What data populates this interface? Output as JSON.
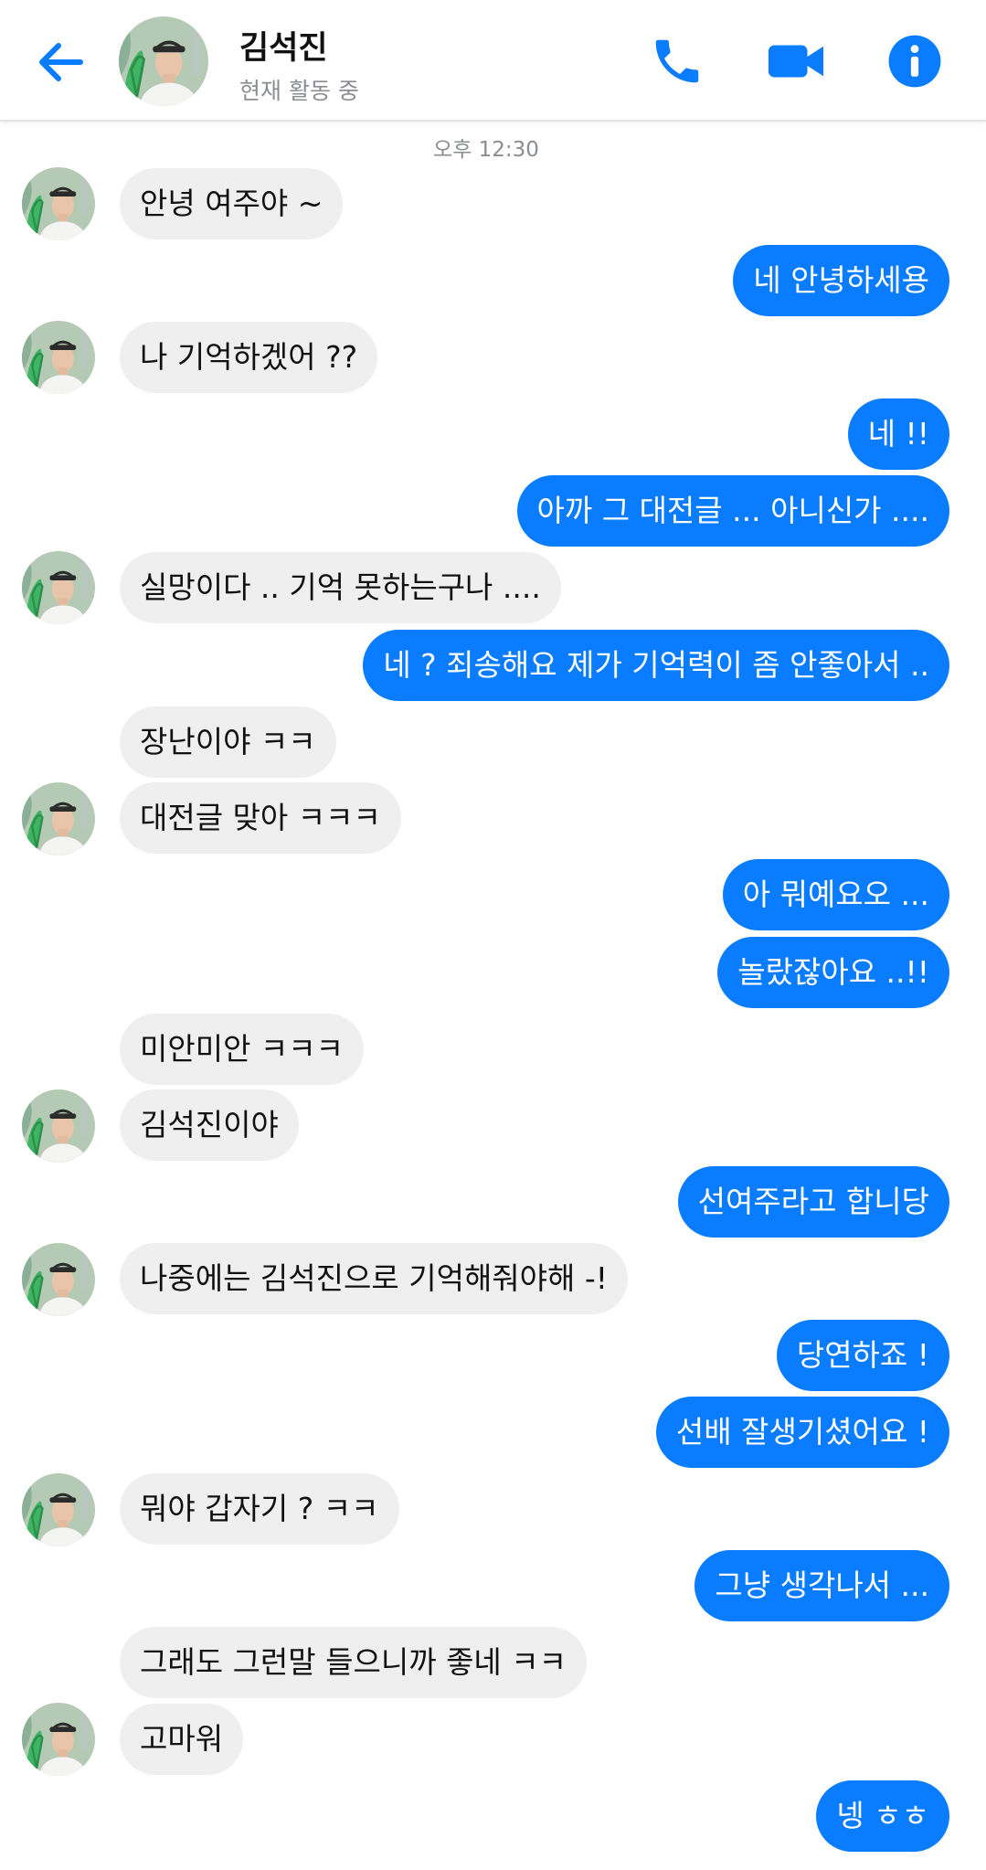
{
  "header": {
    "contact_name": "김석진",
    "status": "현재 활동 중",
    "back_icon": "back-arrow-icon",
    "call_icon": "phone-icon",
    "video_icon": "video-camera-icon",
    "info_icon": "info-icon"
  },
  "colors": {
    "accent": "#0a7cff",
    "incoming_bubble": "#efefef",
    "outgoing_text": "#ffffff"
  },
  "conversation": {
    "timestamp": "오후 12:30",
    "messages": [
      {
        "sender": "them",
        "text": "안녕 여주야 ~"
      },
      {
        "sender": "me",
        "text": "네 안녕하세용"
      },
      {
        "sender": "them",
        "text": "나 기억하겠어 ??"
      },
      {
        "sender": "me",
        "text": "네 !!"
      },
      {
        "sender": "me",
        "text": "아까 그 대전글 ... 아니신가 ...."
      },
      {
        "sender": "them",
        "text": "실망이다 .. 기억 못하는구나 ...."
      },
      {
        "sender": "me",
        "text": "네 ? 죄송해요 제가 기억력이 좀 안좋아서 .."
      },
      {
        "sender": "them",
        "text": "장난이야 ㅋㅋ"
      },
      {
        "sender": "them",
        "text": "대전글 맞아 ㅋㅋㅋ"
      },
      {
        "sender": "me",
        "text": "아 뭐예요오 ..."
      },
      {
        "sender": "me",
        "text": "놀랐잖아요 ..!!"
      },
      {
        "sender": "them",
        "text": "미안미안 ㅋㅋㅋ"
      },
      {
        "sender": "them",
        "text": "김석진이야"
      },
      {
        "sender": "me",
        "text": "선여주라고 합니당"
      },
      {
        "sender": "them",
        "text": "나중에는 김석진으로 기억해줘야해 -!"
      },
      {
        "sender": "me",
        "text": "당연하죠 !"
      },
      {
        "sender": "me",
        "text": "선배 잘생기셨어요 !"
      },
      {
        "sender": "them",
        "text": "뭐야 갑자기 ? ㅋㅋ"
      },
      {
        "sender": "me",
        "text": "그냥 생각나서 ..."
      },
      {
        "sender": "them",
        "text": "그래도 그런말 들으니까 좋네 ㅋㅋ"
      },
      {
        "sender": "them",
        "text": "고마워"
      },
      {
        "sender": "me",
        "text": "넹 ㅎㅎ"
      }
    ]
  }
}
